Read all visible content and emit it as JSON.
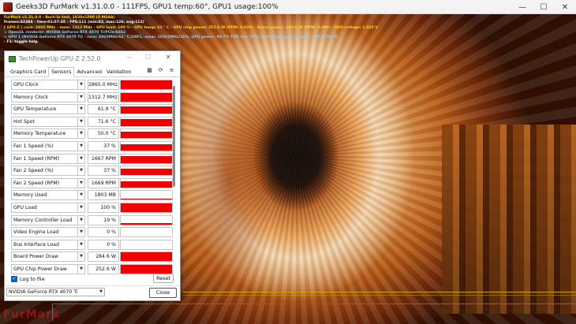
{
  "furmark": {
    "title": "Geeks3D FurMark v1.31.0.0 - 111FPS, GPU1 temp:60°, GPU1 usage:100%",
    "overlay": [
      "FurMark v1.31.0.0 - Burn-in test, 1920x1080 (0 MSAA)",
      "Frames:42384 - time:01:07:45 - FPS:111 (min:82, max:126, avg:112)",
      "[ GPU-Z ] core: 2865 MHz - mem: 1312 MHz - GPU load: 100 % - GPU temp: 61 ° C - GPU chip power: 252.6 W (PPW: 0.439) - Board power: 284.6 W (PPW: 0.390) - GPU voltage: 1.035 V",
      "> OpenGL renderer: NVIDIA GeForce RTX 4070 Ti/PCIe/SSE2",
      "> GPU 1 (NVIDIA GeForce RTX 4070 Ti) - core: 2865MHz/61° C/100%, mem: 10501MHz/10%, GPU power: 96.7% TDP, fan: 37%, limits:[power:1, temp:0, volt:0, OV:0]",
      "- F1: toggle help"
    ],
    "watermark": "FurMark"
  },
  "gpuz": {
    "title": "TechPowerUp GPU-Z 2.52.0",
    "tabs": [
      "Graphics Card",
      "Sensors",
      "Advanced",
      "Validation"
    ],
    "active_tab": "Sensors",
    "sensors": [
      {
        "name": "GPU Clock",
        "value": "2865.0 MHz",
        "level": 1.0
      },
      {
        "name": "Memory Clock",
        "value": "1312.7 MHz",
        "level": 1.0
      },
      {
        "name": "GPU Temperature",
        "value": "61.9 °C",
        "level": 0.8
      },
      {
        "name": "Hot Spot",
        "value": "71.6 °C",
        "level": 0.8
      },
      {
        "name": "Memory Temperature",
        "value": "50.0 °C",
        "level": 0.8
      },
      {
        "name": "Fan 1 Speed (%)",
        "value": "37 %",
        "level": 0.75
      },
      {
        "name": "Fan 1 Speed (RPM)",
        "value": "1667 RPM",
        "level": 0.75
      },
      {
        "name": "Fan 2 Speed (%)",
        "value": "37 %",
        "level": 0.75
      },
      {
        "name": "Fan 2 Speed (RPM)",
        "value": "1669 RPM",
        "level": 0.75
      },
      {
        "name": "Memory Used",
        "value": "1803 MB",
        "level": 0.12
      },
      {
        "name": "GPU Load",
        "value": "100 %",
        "level": 1.0
      },
      {
        "name": "Memory Controller Load",
        "value": "19 %",
        "level": 0.19
      },
      {
        "name": "Video Engine Load",
        "value": "0 %",
        "level": 0.0
      },
      {
        "name": "Bus Interface Load",
        "value": "0 %",
        "level": 0.0
      },
      {
        "name": "Board Power Draw",
        "value": "284.6 W",
        "level": 1.0
      },
      {
        "name": "GPU Chip Power Draw",
        "value": "252.6 W",
        "level": 1.0
      }
    ],
    "log_to_file": "Log to file",
    "reset": "Reset",
    "gpu_select": "NVIDIA GeForce RTX 4070 Ti",
    "close": "Close",
    "colors": {
      "graph_fill": "#f00000",
      "accent": "#0a64c8"
    }
  }
}
